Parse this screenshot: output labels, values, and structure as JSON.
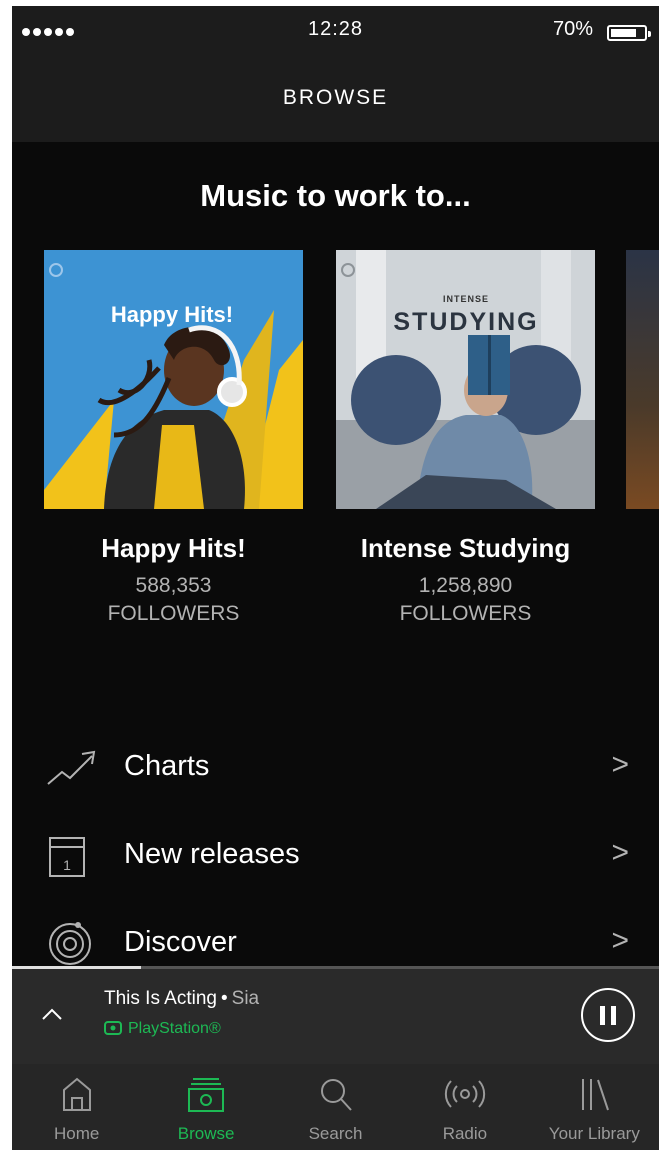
{
  "status": {
    "time": "12:28",
    "battery": "70%"
  },
  "header": {
    "title": "BROWSE"
  },
  "section": {
    "title": "Music to work to..."
  },
  "playlists": [
    {
      "name": "Happy Hits!",
      "art_text": "Happy Hits!",
      "followers": "588,353",
      "followers_label": "FOLLOWERS"
    },
    {
      "name": "Intense Studying",
      "art_text_small": "INTENSE",
      "art_text": "STUDYING",
      "followers": "1,258,890",
      "followers_label": "FOLLOWERS"
    }
  ],
  "menu": [
    {
      "label": "Charts",
      "icon": "chart-line-icon"
    },
    {
      "label": "New releases",
      "icon": "calendar-icon",
      "icon_text": "1"
    },
    {
      "label": "Discover",
      "icon": "discover-icon"
    }
  ],
  "now_playing": {
    "title": "This Is Acting",
    "separator": "•",
    "artist": "Sia",
    "device": "PlayStation®",
    "progress": 0.2
  },
  "tabs": [
    {
      "label": "Home",
      "icon": "home-icon",
      "active": false
    },
    {
      "label": "Browse",
      "icon": "browse-icon",
      "active": true
    },
    {
      "label": "Search",
      "icon": "search-icon",
      "active": false
    },
    {
      "label": "Radio",
      "icon": "radio-icon",
      "active": false
    },
    {
      "label": "Your Library",
      "icon": "library-icon",
      "active": false
    }
  ],
  "colors": {
    "accent": "#1db954",
    "background": "#0a0a0a",
    "bar": "#1c1c1c"
  }
}
